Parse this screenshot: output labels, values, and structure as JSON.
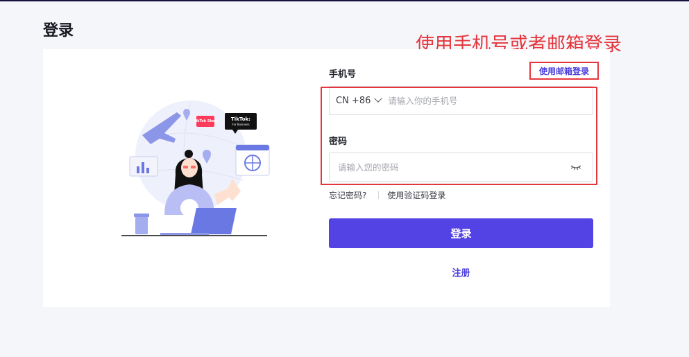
{
  "page": {
    "title": "登录"
  },
  "annotation": {
    "text": "使用手机号或者邮箱登录",
    "color": "#e5363d"
  },
  "illustration": {
    "tiktok_shop_badge": "TikTok Shop",
    "tiktok_business_line1": "TikTok:",
    "tiktok_business_line2": "For Business"
  },
  "form": {
    "phone_label": "手机号",
    "switch_to_email_label": "使用邮箱登录",
    "country_code": "CN +86",
    "phone_placeholder": "请输入你的手机号",
    "password_label": "密码",
    "password_placeholder": "请输入您的密码",
    "forgot_password": "忘记密码?",
    "code_login": "使用验证码登录",
    "login_button": "登录",
    "register_link": "注册"
  },
  "colors": {
    "accent": "#5443e4",
    "link": "#4a3fdc",
    "highlight": "#e5363d"
  },
  "icons": {
    "country_dropdown": "chevron-down-icon",
    "password_toggle": "eye-closed-icon"
  }
}
